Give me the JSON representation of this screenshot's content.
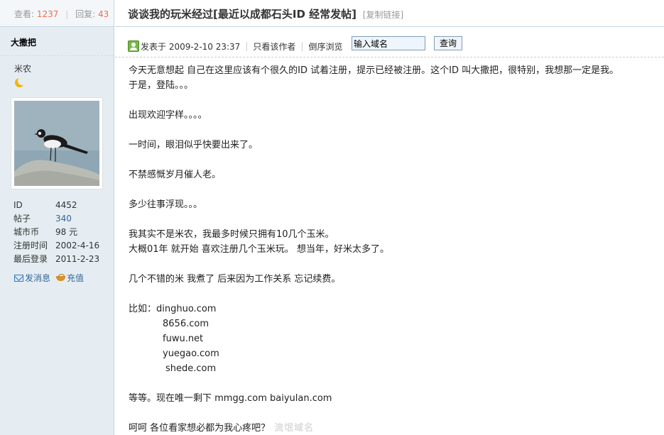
{
  "stats": {
    "views_label": "查看:",
    "views": "1237",
    "replies_label": "回复:",
    "replies": "43"
  },
  "author": {
    "name": "大撒把",
    "group": "米农",
    "id_label": "ID",
    "id": "4452",
    "posts_label": "帖子",
    "posts": "340",
    "coins_label": "城市币",
    "coins": "98 元",
    "reg_label": "注册时间",
    "reg": "2002-4-16",
    "last_label": "最后登录",
    "last": "2011-2-23",
    "message": "发消息",
    "recharge": "充值"
  },
  "thread": {
    "title": "谈谈我的玩米经过[最近以成都石头ID 经常发帖]",
    "copy_link": "[复制链接]"
  },
  "meta": {
    "posted": "发表于 2009-2-10 23:37",
    "only_author": "只看该作者",
    "reverse": "倒序浏览",
    "domain_placeholder": "输入域名",
    "query": "查询"
  },
  "body": {
    "p1": "今天无意想起 自己在这里应该有个很久的ID   试着注册，提示已经被注册。这个ID 叫大撒把，很特别，我想那一定是我。",
    "p1b": "于是，登陆。。。",
    "p2": "出现欢迎字样。。。。",
    "p3": "一时间，眼泪似乎快要出来了。",
    "p4": "不禁感慨岁月催人老。",
    "p5": "多少往事浮现。。。",
    "p6": "我其实不是米农，我最多时候只拥有10几个玉米。",
    "p6b": "大概01年 就开始 喜欢注册几个玉米玩。  想当年，好米太多了。",
    "p7": "几个不错的米 我煮了 后来因为工作关系 忘记续费。",
    "p8": "比如：dinghuo.com",
    "d2": "8656.com",
    "d3": "fuwu.net",
    "d4": "yuegao.com",
    "d5": "shede.com",
    "p9": "等等。现在唯一剩下 mmgg.com  baiyulan.com",
    "p10": "呵呵 各位看家想必都为我心疼吧？",
    "watermark": "流氓域名"
  },
  "colors": {
    "accent_num": "#f26c4f",
    "link": "#336699",
    "sidebar_bg": "#e5edf2"
  }
}
